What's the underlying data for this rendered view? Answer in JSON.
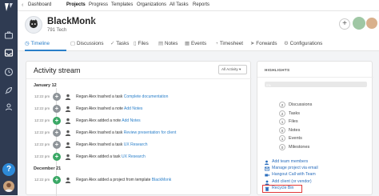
{
  "nav": {
    "items": [
      "Dashboard",
      "Projects",
      "Progress",
      "Templates",
      "Organizations",
      "All Tasks",
      "Reports"
    ],
    "active": "Projects"
  },
  "project": {
    "name": "BlackMonk",
    "subtitle": "791 Tech"
  },
  "tabs": [
    "Timeline",
    "Discussions",
    "Tasks",
    "Files",
    "Notes",
    "Events",
    "Timesheet",
    "Forwards",
    "Configurations"
  ],
  "activity": {
    "title": "Activity stream",
    "filter": "All Activity",
    "groups": [
      {
        "date": "January 12",
        "events": [
          {
            "time": "12:22 pm",
            "icon": "grey",
            "text": "Regan Alex trashed a task ",
            "link": "Complete documentation"
          },
          {
            "time": "12:22 pm",
            "icon": "grey",
            "text": "Regan Alex trashed a note ",
            "link": "Add Notes"
          },
          {
            "time": "12:22 pm",
            "icon": "green",
            "text": "Regan Alex added a note ",
            "link": "Add Notes"
          },
          {
            "time": "12:22 pm",
            "icon": "grey",
            "text": "Regan Alex trashed a task ",
            "link": "Review presentation for client"
          },
          {
            "time": "12:22 pm",
            "icon": "grey",
            "text": "Regan Alex trashed a task ",
            "link": "UX Research"
          },
          {
            "time": "12:22 pm",
            "icon": "green",
            "text": "Regan Alex added a task ",
            "link": "UX Research"
          }
        ]
      },
      {
        "date": "December 21",
        "events": [
          {
            "time": "12:22 pm",
            "icon": "green",
            "text": "Regan Alex added a project from template ",
            "link": "BlackMonk"
          }
        ]
      }
    ]
  },
  "highlights": {
    "title": "HIGHLIGHTS",
    "progress_label": "0%",
    "progress": 0,
    "stats": [
      {
        "count": "2",
        "label": "Discussions"
      },
      {
        "count": "2",
        "label": "Tasks"
      },
      {
        "count": "1",
        "label": "Files"
      },
      {
        "count": "0",
        "label": "Notes"
      },
      {
        "count": "1",
        "label": "Events"
      },
      {
        "count": "0",
        "label": "Milestones"
      }
    ],
    "links": [
      {
        "label": "Add team members",
        "icon": "user-plus-icon"
      },
      {
        "label": "Manage project via email",
        "icon": "mail-icon"
      },
      {
        "label": "Hangout Call with Team",
        "icon": "video-icon"
      },
      {
        "label": "Add client (or vendor)",
        "icon": "user-icon"
      },
      {
        "label": "Recycle Bin",
        "icon": "trash-icon"
      }
    ]
  },
  "colors": {
    "accent": "#2a7fc9",
    "sidebar": "#2f3b52",
    "highlight": "#e03a3a",
    "success": "#3aa865"
  }
}
